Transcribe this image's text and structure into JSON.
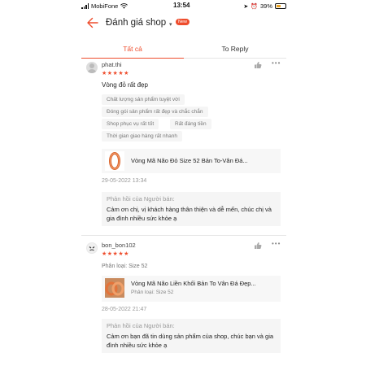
{
  "status_bar": {
    "carrier": "MobiFone",
    "time": "13:54",
    "battery": "39%"
  },
  "header": {
    "title": "Đánh giá shop",
    "badge": "New"
  },
  "tabs": [
    {
      "label": "Tất cả",
      "active": true
    },
    {
      "label": "To Reply",
      "active": false
    }
  ],
  "colors": {
    "accent": "#ee4d2d"
  },
  "reviews": [
    {
      "username": "phat.thi",
      "rating": 5,
      "stars": "★★★★★",
      "comment": "Vòng đỏ rất đẹp",
      "tags": [
        "Chất lượng sản phẩm tuyệt vời",
        "Đóng gói sản phẩm rất đẹp và chắc chắn",
        "Shop phục vụ rất tốt",
        "Rất đáng tiền",
        "Thời gian giao hàng rất nhanh"
      ],
      "product": "Vòng Mã Não Đỏ Size 52 Bản To-Vân Đá...",
      "date": "29-05-2022 13:34",
      "reply_label": "Phản hồi của Người bán:",
      "reply_text": "Cảm ơn chị, vị khách hàng thân thiện và dễ mến, chúc chị và gia đình nhiều sức khỏe ạ"
    },
    {
      "username": "bon_bon102",
      "rating": 5,
      "stars": "★★★★★",
      "variant": "Phân loại: Size 52",
      "product": "Vòng Mã Não Liền Khối Bản To Vân Đá Đẹp...",
      "product_variant": "Phân loại: Size 52",
      "date": "28-05-2022 21:47",
      "reply_label": "Phản hồi của Người bán:",
      "reply_text": "Cảm ơn bạn đã tin dùng sản phẩm của shop, chúc bạn và gia đình nhiều sức khỏe ạ"
    }
  ]
}
